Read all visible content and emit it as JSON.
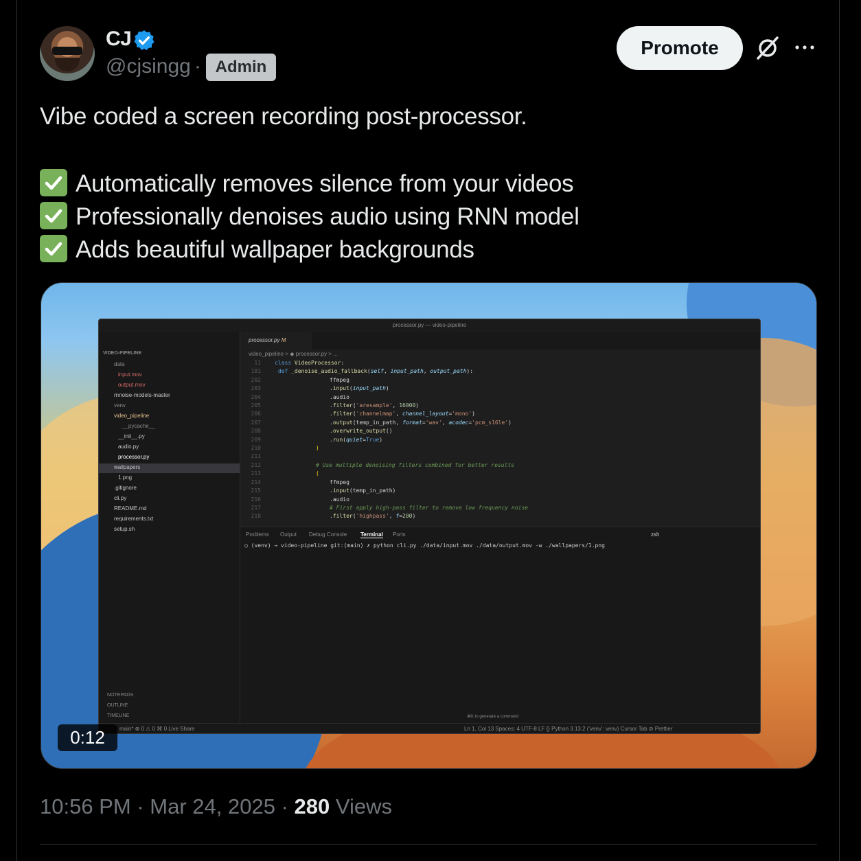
{
  "author": {
    "name": "CJ",
    "handle": "@cjsingg",
    "separator": "·",
    "role_badge": "Admin",
    "verified_icon": "verified-badge-icon",
    "avatar_icon": "avatar"
  },
  "actions": {
    "promote_label": "Promote",
    "grok_icon": "grok-icon",
    "more_icon": "more-icon"
  },
  "tweet": {
    "line1": "Vibe coded a screen recording post-processor.",
    "bullets": [
      "Automatically removes silence from your videos",
      "Professionally denoises audio using RNN model",
      "Adds beautiful wallpaper backgrounds"
    ],
    "bullet_icon": "check-mark-button-icon"
  },
  "media": {
    "duration": "0:12",
    "editor": {
      "window_title": "processor.py — video-pipeline",
      "tab_label": "processor.py",
      "tab_badge": "M",
      "breadcrumb": "video_pipeline  >  ◆ processor.py  > ...",
      "sidebar": {
        "root": "VIDEO-PIPELINE",
        "items": [
          "data",
          "input.mov",
          "output.mov",
          "rnnoise-models-master",
          "venv",
          "video_pipeline",
          "__pycache__",
          "__init__.py",
          "audio.py",
          "processor.py",
          "wallpapers",
          "1.png",
          ".gitignore",
          "cli.py",
          "README.md",
          "requirements.txt",
          "setup.sh"
        ],
        "sections": [
          "NOTEPADS",
          "OUTLINE",
          "TIMELINE"
        ]
      },
      "code_lines": [
        {
          "n": "11",
          "t": "class VideoProcessor:"
        },
        {
          "n": "181",
          "t": "    def _denoise_audio_fallback(self, input_path, output_path):"
        },
        {
          "n": "202",
          "t": "ffmpeg"
        },
        {
          "n": "203",
          "t": ".input(input_path)"
        },
        {
          "n": "204",
          "t": ".audio"
        },
        {
          "n": "205",
          "t": ".filter('aresample', 16000)"
        },
        {
          "n": "206",
          "t": ".filter('channelmap', channel_layout='mono')"
        },
        {
          "n": "207",
          "t": ".output(temp_in_path, format='wav', acodec='pcm_s16le')"
        },
        {
          "n": "208",
          "t": ".overwrite_output()"
        },
        {
          "n": "209",
          "t": ".run(quiet=True)"
        },
        {
          "n": "210",
          "t": ")"
        },
        {
          "n": "211",
          "t": ""
        },
        {
          "n": "212",
          "t": "# Use multiple denoising filters combined for better results"
        },
        {
          "n": "213",
          "t": "("
        },
        {
          "n": "214",
          "t": "ffmpeg"
        },
        {
          "n": "215",
          "t": ".input(temp_in_path)"
        },
        {
          "n": "216",
          "t": ".audio"
        },
        {
          "n": "217",
          "t": "# First apply high-pass filter to remove low frequency noise"
        },
        {
          "n": "218",
          "t": ".filter('highpass', f=200)"
        }
      ],
      "panel_tabs": [
        "Problems",
        "Output",
        "Debug Console",
        "Terminal",
        "Ports"
      ],
      "terminal_shell": "zsh",
      "terminal_line": "○ (venv) →  video-pipeline git:(main) ✗ python cli.py  ./data/input.mov ./data/output.mov -w ./wallpapers/1.png",
      "hint": "⌘K to generate a command",
      "status_left": "main*  ⊗ 0 ⚠ 0   ⌘ 0   Live Share",
      "status_right": "Ln 1, Col 13   Spaces: 4   UTF-8   LF   {} Python   3.13.2 ('venv': venv)   Cursor Tab   ⊘ Prettier"
    }
  },
  "footer": {
    "time": "10:56 PM",
    "sep1": " · ",
    "date": "Mar 24, 2025",
    "sep2": " · ",
    "views_count": "280",
    "views_label": " Views"
  },
  "colors": {
    "background": "#000000",
    "text": "#e7e9ea",
    "secondary": "#71767b",
    "verified": "#1d9bf0",
    "check_green": "#78b159"
  }
}
